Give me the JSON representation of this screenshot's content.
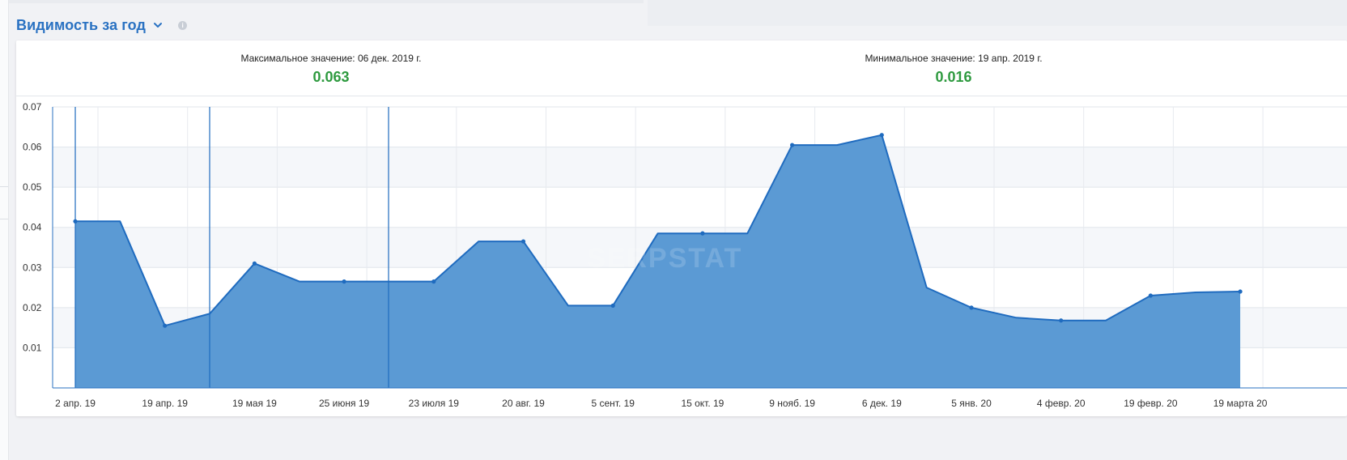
{
  "header": {
    "title": "Видимость за год"
  },
  "stats": {
    "max_label": "Максимальное значение: 06 дек. 2019 г.",
    "max_value": "0.063",
    "min_label": "Минимальное значение: 19 апр. 2019 г.",
    "min_value": "0.016"
  },
  "watermark": "SERPSTAT",
  "colors": {
    "accent": "#2a72c2",
    "area_fill": "#5b9ad4",
    "line": "#1f6bbf",
    "positive": "#2e9a3f"
  },
  "chart_data": {
    "type": "area",
    "title": "",
    "xlabel": "",
    "ylabel": "",
    "ylim": [
      0,
      0.07
    ],
    "yticks": [
      "0.01",
      "0.02",
      "0.03",
      "0.04",
      "0.05",
      "0.06",
      "0.07"
    ],
    "xticks": [
      "2 апр. 19",
      "19 апр. 19",
      "19 мая 19",
      "25 июня 19",
      "23 июля 19",
      "20 авг. 19",
      "5 сент. 19",
      "15 окт. 19",
      "9 нояб. 19",
      "6 дек. 19",
      "5 янв. 20",
      "4 февр. 20",
      "19 февр. 20",
      "19 марта 20"
    ],
    "grid": true,
    "legend": "none",
    "series": [
      {
        "values": [
          0.0415,
          0.0415,
          0.0155,
          0.0185,
          0.031,
          0.0265,
          0.0265,
          0.0265,
          0.0265,
          0.0365,
          0.0365,
          0.0205,
          0.0205,
          0.0385,
          0.0385,
          0.0385,
          0.0605,
          0.0605,
          0.063,
          0.025,
          0.02,
          0.0175,
          0.0168,
          0.0168,
          0.023,
          0.0238,
          0.024
        ]
      }
    ]
  }
}
